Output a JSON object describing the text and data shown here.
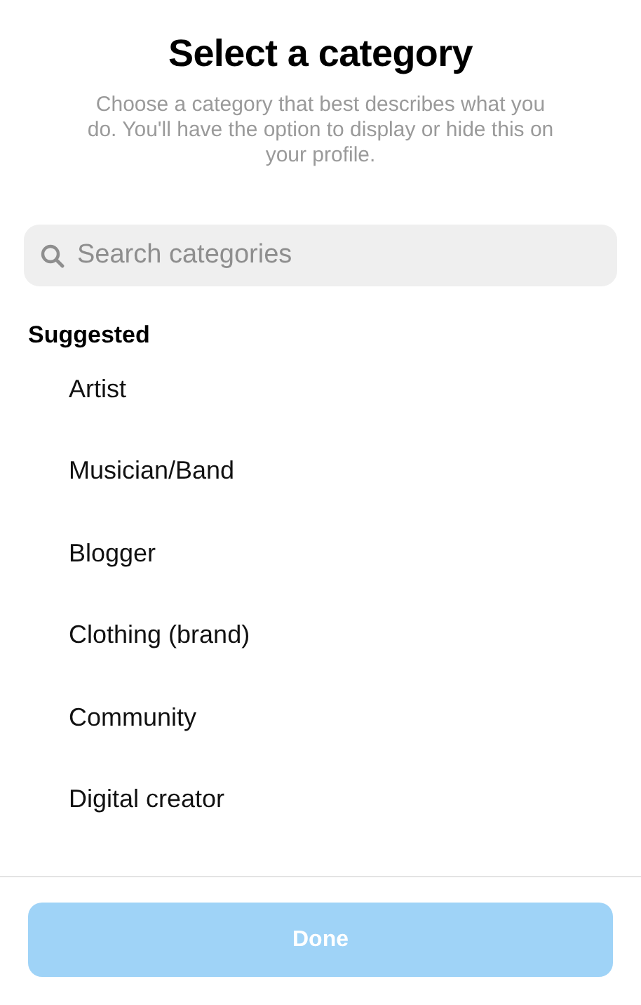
{
  "title": "Select a category",
  "description": "Choose a category that best describes what you do. You'll have the option to display or hide this on your profile.",
  "search": {
    "placeholder": "Search categories"
  },
  "section": "Suggested",
  "categories": [
    {
      "label": "Artist"
    },
    {
      "label": "Musician/Band"
    },
    {
      "label": "Blogger"
    },
    {
      "label": "Clothing (brand)"
    },
    {
      "label": "Community"
    },
    {
      "label": "Digital creator"
    }
  ],
  "done_button": {
    "label": "Done",
    "disabled": true
  }
}
